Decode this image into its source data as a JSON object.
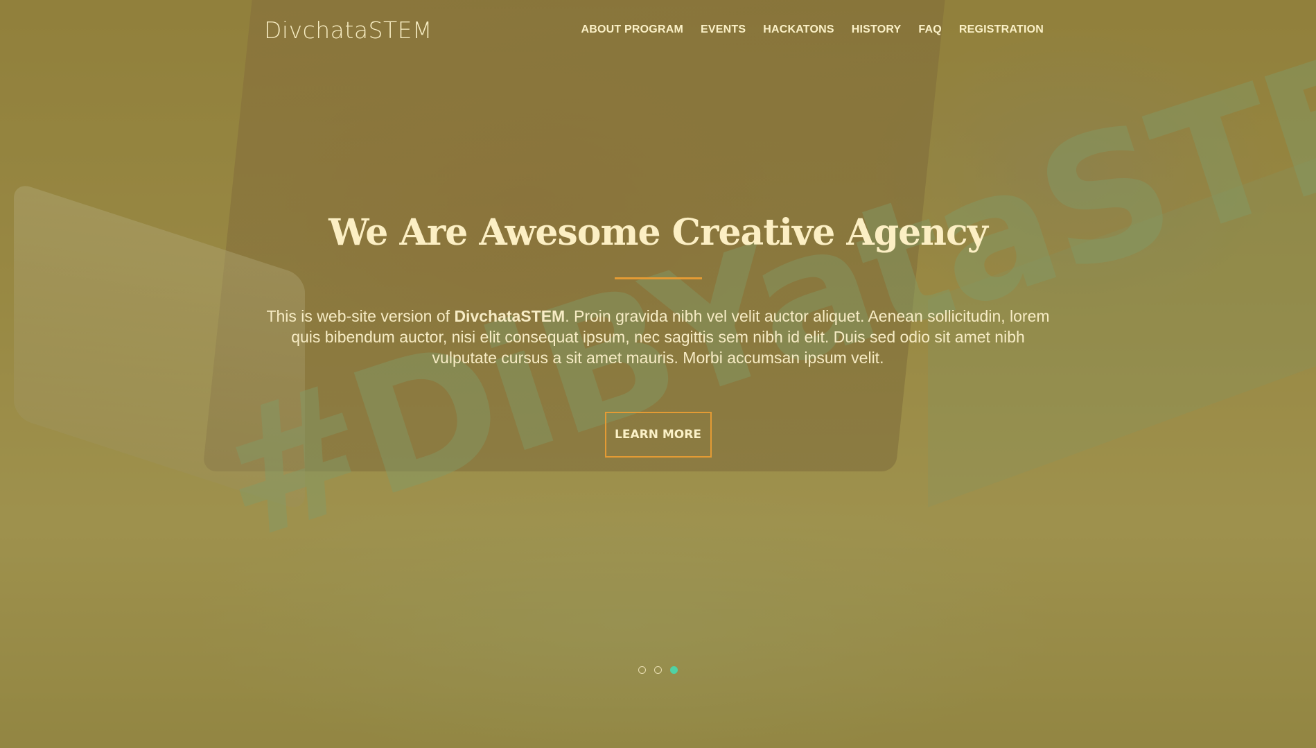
{
  "navbar": {
    "brand": "DivchataSTEM",
    "items": [
      {
        "label": "ABOUT PROGRAM"
      },
      {
        "label": "EVENTS"
      },
      {
        "label": "HACKATONS"
      },
      {
        "label": "HISTORY"
      },
      {
        "label": "FAQ"
      },
      {
        "label": "REGISTRATION"
      }
    ]
  },
  "hero": {
    "background_sticker_text": "#DiBYataSTEM",
    "title": "We Are Awesome Creative Agency",
    "lead_prefix": "This is web-site version of ",
    "lead_brand": "DivchataSTEM",
    "lead_suffix": ". Proin gravida nibh vel velit auctor aliquet. Aenean sollicitudin, lorem quis bibendum auctor, nisi elit consequat ipsum, nec sagittis sem nibh id elit. Duis sed odio sit amet nibh vulputate cursus a sit amet mauris. Morbi accumsan ipsum velit.",
    "cta_label": "LEARN MORE"
  },
  "slider": {
    "total": 3,
    "active_index": 2
  },
  "colors": {
    "accent": "#e49b34",
    "active_dot": "#4fd2a5",
    "text": "#fcefc4",
    "overlay": "#96873c"
  }
}
